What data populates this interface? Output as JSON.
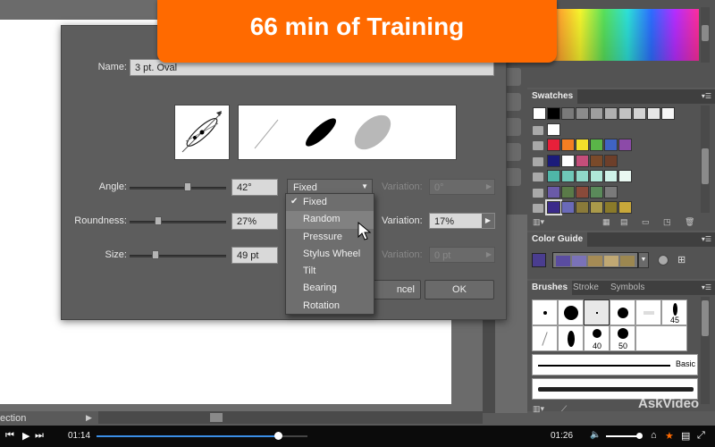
{
  "banner": {
    "text": "66 min of Training"
  },
  "dialog": {
    "name_label": "Name:",
    "name_value": "3 pt. Oval",
    "angle": {
      "label": "Angle:",
      "value": "42°",
      "slider_fraction": 0.64,
      "mode": "Fixed",
      "variation_label": "Variation:",
      "variation_value": "0°"
    },
    "roundness": {
      "label": "Roundness:",
      "value": "27%",
      "slider_fraction": 0.27,
      "variation_label": "Variation:",
      "variation_value": "17%"
    },
    "size": {
      "label": "Size:",
      "value": "49 pt",
      "slider_fraction": 0.24,
      "variation_label": "Variation:",
      "variation_value": "0 pt"
    },
    "cancel_label": "ncel",
    "ok_label": "OK"
  },
  "dropdown": {
    "items": [
      "Fixed",
      "Random",
      "Pressure",
      "Stylus Wheel",
      "Tilt",
      "Bearing",
      "Rotation"
    ],
    "checked": "Fixed",
    "highlighted": "Random"
  },
  "status": {
    "text": "ection"
  },
  "panels": {
    "swatches_tab": "Swatches",
    "color_guide_tab": "Color Guide",
    "brushes_tab": "Brushes",
    "stroke_tab": "Stroke",
    "symbols_tab": "Symbols",
    "brush_sizes": [
      "45",
      "40",
      "50"
    ],
    "basic_label": "Basic"
  },
  "player": {
    "elapsed": "01:14",
    "duration": "01:26",
    "progress_fraction": 0.86
  },
  "watermark": "AskVideo",
  "colors": {
    "banner": "#ff6a00",
    "progress": "#3a8ee6",
    "player_bg": "#0b0b0b"
  }
}
